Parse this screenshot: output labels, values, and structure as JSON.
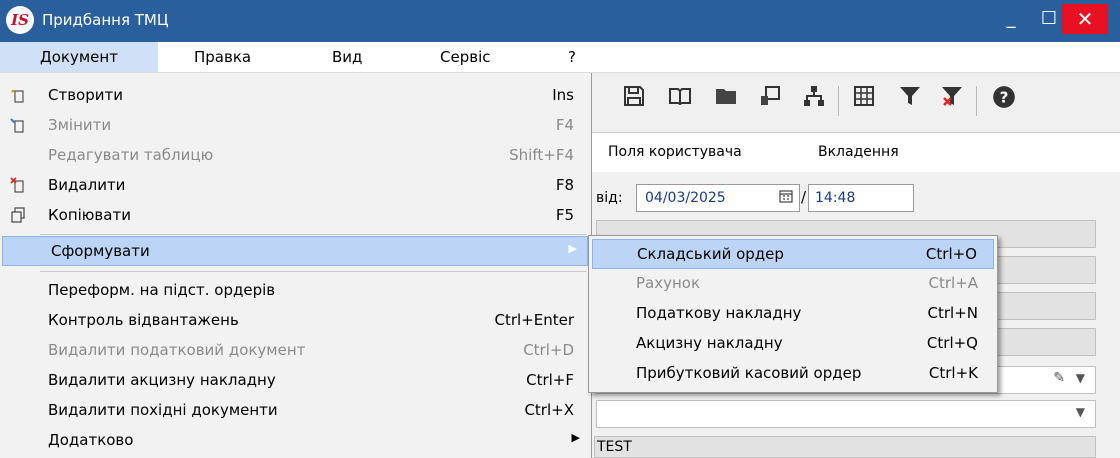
{
  "window": {
    "title": "Придбання ТМЦ",
    "logo": "IS",
    "controls": {
      "minimize": "_",
      "maximize": "☐",
      "close": "✕"
    }
  },
  "menubar": {
    "items": [
      {
        "label": "Документ"
      },
      {
        "label": "Правка"
      },
      {
        "label": "Вид"
      },
      {
        "label": "Сервіс"
      },
      {
        "label": "?"
      }
    ]
  },
  "doc_menu": {
    "items": [
      {
        "label": "Створити",
        "shortcut": "Ins",
        "icon": "new-document-icon",
        "enabled": true
      },
      {
        "label": "Змінити",
        "shortcut": "F4",
        "icon": "edit-document-icon",
        "enabled": false
      },
      {
        "label": "Редагувати таблицю",
        "shortcut": "Shift+F4",
        "enabled": false
      },
      {
        "label": "Видалити",
        "shortcut": "F8",
        "icon": "delete-document-icon",
        "enabled": true
      },
      {
        "label": "Копіювати",
        "shortcut": "F5",
        "icon": "copy-icon",
        "enabled": true
      },
      {
        "label": "Сформувати",
        "shortcut": "",
        "submenu": true,
        "highlighted": true,
        "enabled": true
      },
      {
        "label": "Переформ. на підст. ордерів",
        "shortcut": "",
        "enabled": true
      },
      {
        "label": "Контроль відвантажень",
        "shortcut": "Ctrl+Enter",
        "enabled": true
      },
      {
        "label": "Видалити податковий документ",
        "shortcut": "Ctrl+D",
        "enabled": false
      },
      {
        "label": "Видалити акцизну накладну",
        "shortcut": "Ctrl+F",
        "enabled": true
      },
      {
        "label": "Видалити похідні документи",
        "shortcut": "Ctrl+X",
        "enabled": true
      },
      {
        "label": "Додатково",
        "shortcut": "",
        "submenu": true,
        "enabled": true
      }
    ]
  },
  "sub_menu": {
    "items": [
      {
        "label": "Складський ордер",
        "shortcut": "Ctrl+O",
        "highlighted": true,
        "enabled": true
      },
      {
        "label": "Рахунок",
        "shortcut": "Ctrl+A",
        "enabled": false
      },
      {
        "label": "Податкову накладну",
        "shortcut": "Ctrl+N",
        "enabled": true
      },
      {
        "label": "Акцизну накладну",
        "shortcut": "Ctrl+Q",
        "enabled": true
      },
      {
        "label": "Прибутковий касовий ордер",
        "shortcut": "Ctrl+K",
        "enabled": true
      }
    ]
  },
  "tabs": [
    {
      "label": "Поля користувача"
    },
    {
      "label": "Вкладення"
    }
  ],
  "form": {
    "date_label_fragment": "від:",
    "date": "04/03/2025",
    "time": "14:48",
    "test_field_fragment": "TEST"
  },
  "colors": {
    "titlebar": "#2a5f9e",
    "close_button": "#e81123",
    "highlight": "#bcd5f6",
    "menu_background": "#f2f2f2"
  }
}
